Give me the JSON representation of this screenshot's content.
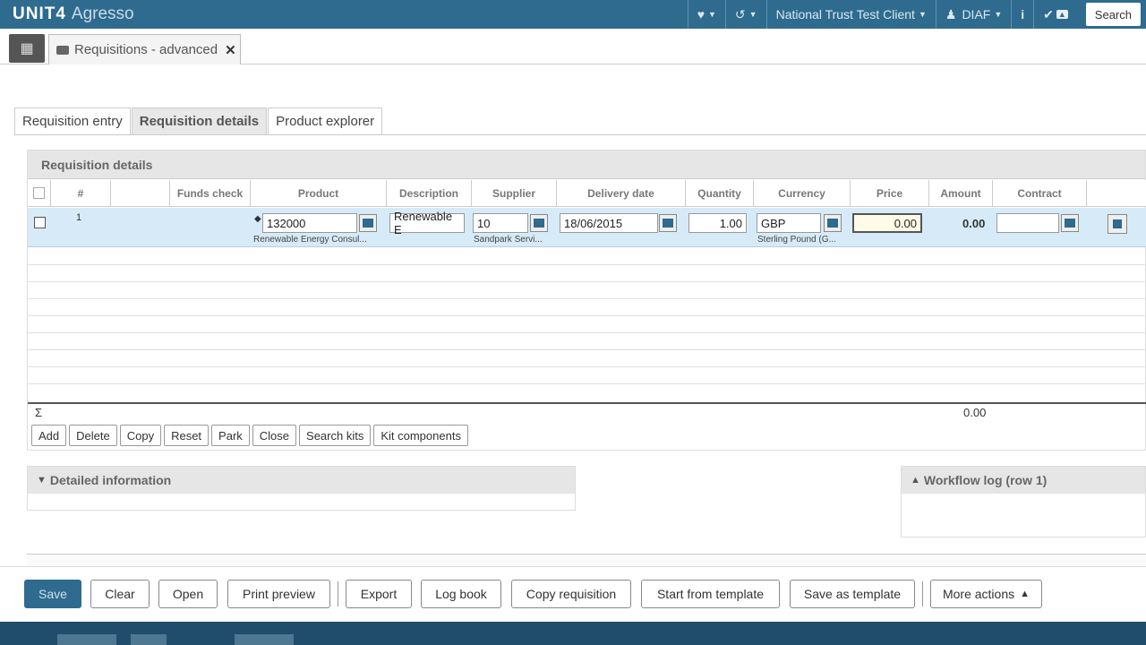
{
  "brand": {
    "name": "UNIT4",
    "product": "Agresso"
  },
  "topbar": {
    "client": "National Trust Test Client",
    "user": "DIAF",
    "info": "i",
    "search_label": "Search"
  },
  "window_tab": {
    "title": "Requisitions - advanced",
    "close": "✕"
  },
  "subtabs": [
    "Requisition entry",
    "Requisition details",
    "Product explorer"
  ],
  "panel": {
    "title": "Requisition details"
  },
  "grid": {
    "columns": [
      "#",
      "",
      "Funds check",
      "Product",
      "Description",
      "Supplier",
      "Delivery date",
      "Quantity",
      "Currency",
      "Price",
      "Amount",
      "Contract"
    ],
    "row": {
      "number": "1",
      "product": "132000",
      "product_desc": "Renewable Energy Consul...",
      "description": "Renewable E",
      "supplier": "10",
      "supplier_desc": "Sandpark Servi...",
      "delivery_date": "18/06/2015",
      "quantity": "1.00",
      "currency": "GBP",
      "currency_desc": "Sterling Pound (G...",
      "price": "0.00",
      "amount": "0.00",
      "contract": ""
    },
    "sum_symbol": "Σ",
    "sum_amount": "0.00"
  },
  "row_actions": [
    "Add",
    "Delete",
    "Copy",
    "Reset",
    "Park",
    "Close",
    "Search kits",
    "Kit components"
  ],
  "sections": {
    "detailed": "Detailed information",
    "workflow": "Workflow log (row 1)"
  },
  "bottom_actions": {
    "save": "Save",
    "clear": "Clear",
    "open": "Open",
    "print_preview": "Print preview",
    "export": "Export",
    "log_book": "Log book",
    "copy_requisition": "Copy requisition",
    "start_from_template": "Start from template",
    "save_as_template": "Save as template",
    "more_actions": "More actions"
  }
}
